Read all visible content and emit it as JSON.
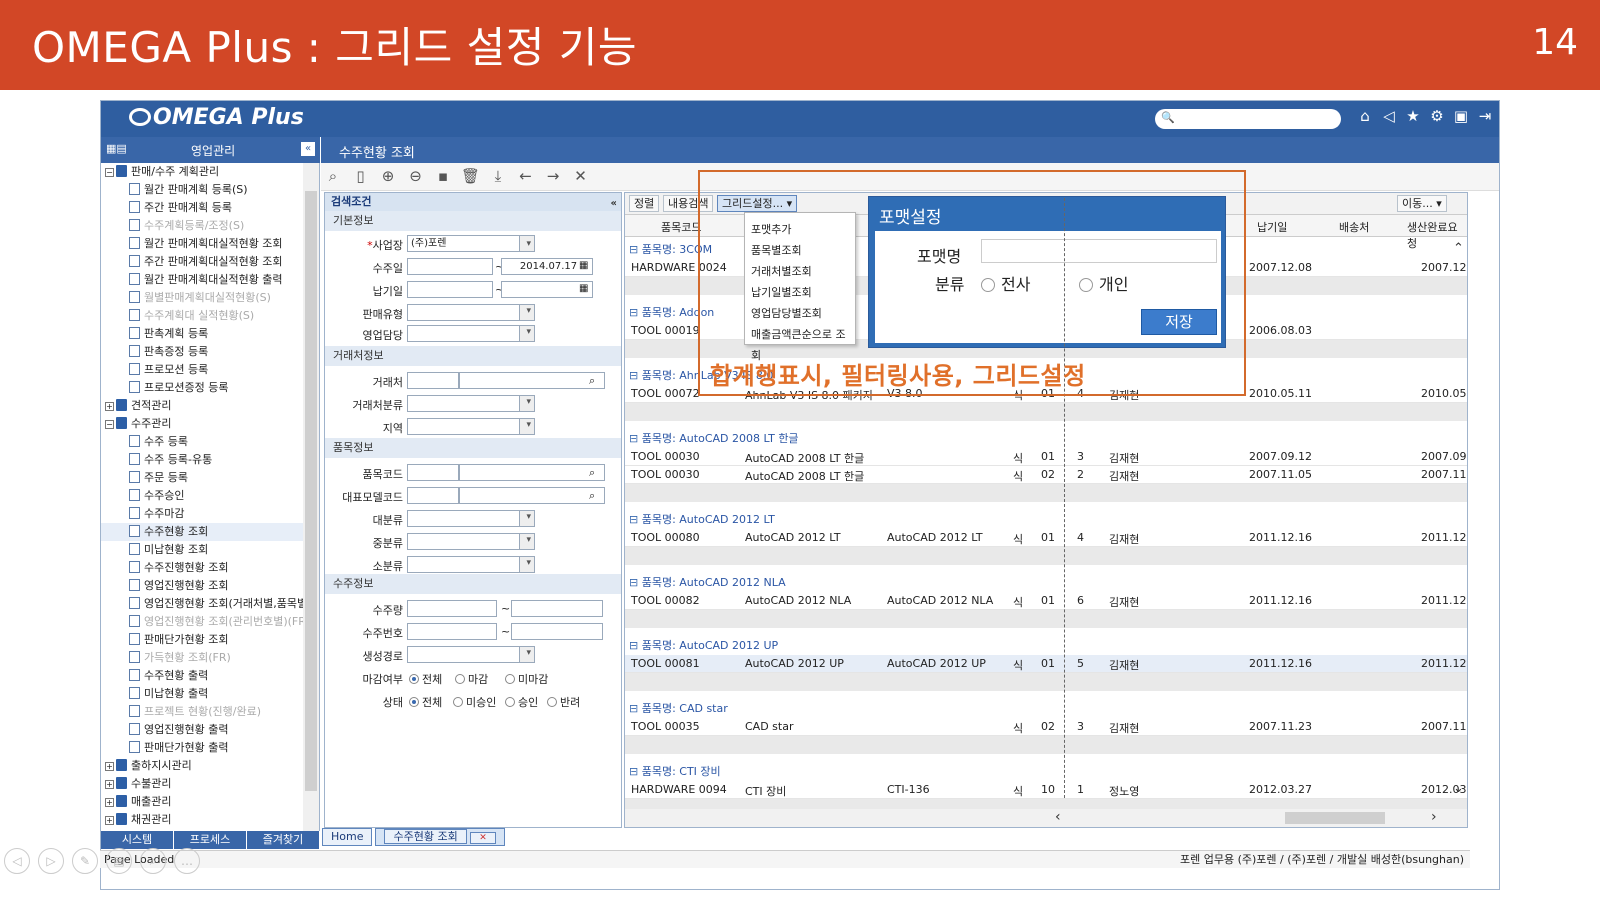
{
  "slide": {
    "title": "OMEGA Plus : 그리드 설정 기능",
    "number": "14"
  },
  "app": {
    "logo": "OMEGA Plus",
    "search_icon": "search-icon",
    "top_icons": [
      "home-icon",
      "back-icon",
      "star-icon",
      "gear-icon",
      "layout-icon",
      "logout-icon"
    ]
  },
  "sidebar": {
    "header": "영업관리",
    "items": [
      {
        "label": "판매/수주 계획관리",
        "type": "folder",
        "open": true
      },
      {
        "label": "월간 판매계획 등록(S)",
        "type": "page"
      },
      {
        "label": "주간 판매계획 등록",
        "type": "page"
      },
      {
        "label": "수주계획등록/조정(S)",
        "type": "page",
        "disabled": true
      },
      {
        "label": "월간 판매계획대실적현황 조회",
        "type": "page"
      },
      {
        "label": "주간 판매계획대실적현황 조회",
        "type": "page"
      },
      {
        "label": "월간 판매계획대실적현황 출력",
        "type": "page"
      },
      {
        "label": "월별판매계획대실적현황(S)",
        "type": "page",
        "disabled": true
      },
      {
        "label": "수주계획대 실적현황(S)",
        "type": "page",
        "disabled": true
      },
      {
        "label": "판촉계획 등록",
        "type": "page"
      },
      {
        "label": "판촉증정 등록",
        "type": "page"
      },
      {
        "label": "프로모션 등록",
        "type": "page"
      },
      {
        "label": "프로모션증정 등록",
        "type": "page"
      },
      {
        "label": "견적관리",
        "type": "folder",
        "open": false
      },
      {
        "label": "수주관리",
        "type": "folder",
        "open": true
      },
      {
        "label": "수주 등록",
        "type": "page"
      },
      {
        "label": "수주 등록-유통",
        "type": "page"
      },
      {
        "label": "주문 등록",
        "type": "page"
      },
      {
        "label": "수주승인",
        "type": "page"
      },
      {
        "label": "수주마감",
        "type": "page"
      },
      {
        "label": "수주현황 조회",
        "type": "page",
        "selected": true
      },
      {
        "label": "미납현황 조회",
        "type": "page"
      },
      {
        "label": "수주진행현황 조회",
        "type": "page"
      },
      {
        "label": "영업진행현황 조회",
        "type": "page"
      },
      {
        "label": "영업진행현황 조회(거래처별,품목별)",
        "type": "page"
      },
      {
        "label": "영업진행현황 조회(관리번호별)(FR)",
        "type": "page",
        "disabled": true
      },
      {
        "label": "판매단가현황 조회",
        "type": "page"
      },
      {
        "label": "가득현황 조회(FR)",
        "type": "page",
        "disabled": true
      },
      {
        "label": "수주현황 출력",
        "type": "page"
      },
      {
        "label": "미납현황 출력",
        "type": "page"
      },
      {
        "label": "프로젝트 현황(진행/완료)",
        "type": "page",
        "disabled": true
      },
      {
        "label": "영업진행현황 출력",
        "type": "page"
      },
      {
        "label": "판매단가현황 출력",
        "type": "page"
      },
      {
        "label": "출하지시관리",
        "type": "folder",
        "open": false
      },
      {
        "label": "수불관리",
        "type": "folder",
        "open": false
      },
      {
        "label": "매출관리",
        "type": "folder",
        "open": false
      },
      {
        "label": "채권관리",
        "type": "folder",
        "open": false
      }
    ],
    "tabs": [
      "시스템",
      "프로세스",
      "즐겨찾기"
    ]
  },
  "main": {
    "title": "수주현황 조회",
    "toolbar_icons": [
      "search-icon",
      "new-icon",
      "add-icon",
      "remove-icon",
      "save-icon",
      "delete-icon",
      "download-icon",
      "prev-icon",
      "next-icon",
      "close-icon"
    ]
  },
  "search_panel": {
    "title": "검색조건",
    "sections": {
      "basic": "기본정보",
      "partner": "거래처정보",
      "item": "품목정보",
      "order": "수주정보"
    },
    "fields": {
      "business": "사업장",
      "business_value": "(주)포렌",
      "order_date": "수주일",
      "order_date_to": "2014.07.17",
      "due_date": "납기일",
      "sales_type": "판매유형",
      "sales_rep": "영업담당",
      "partner": "거래처",
      "partner_class": "거래처분류",
      "region": "지역",
      "item_code": "품목코드",
      "model_code": "대표모델코드",
      "cat_large": "대분류",
      "cat_mid": "중분류",
      "cat_small": "소분류",
      "qty": "수주량",
      "order_no": "수주번호",
      "route": "생성경로",
      "closing": "마감여부",
      "state": "상태"
    },
    "closing_options": [
      "전체",
      "마감",
      "미마감"
    ],
    "state_options": [
      "전체",
      "미승인",
      "승인",
      "반려"
    ],
    "tilde": "~"
  },
  "grid": {
    "toolbar": {
      "sort": "정렬",
      "content_search": "내용검색",
      "grid_settings": "그리드설정...",
      "move": "이동..."
    },
    "columns": {
      "item_code": "품목코드",
      "due": "납기일",
      "ship": "배송처",
      "done": "생산완료요청"
    },
    "group_prefix": "품목명: ",
    "groups": [
      {
        "name": "3COM",
        "rows": [
          {
            "code": "HARDWARE 0024",
            "name": "",
            "spec": "",
            "unit": "",
            "cat": "",
            "qty": "",
            "rep": "",
            "due": "2007.12.08",
            "done": "2007.12"
          }
        ]
      },
      {
        "name": "Addon",
        "rows": [
          {
            "code": "TOOL 00019",
            "name": "",
            "spec": "",
            "unit": "",
            "cat": "",
            "qty": "",
            "rep": "",
            "due": "2006.08.03",
            "done": ""
          }
        ]
      },
      {
        "name": "AhnLab V3 IS 8.0",
        "rows": [
          {
            "code": "TOOL 00072",
            "name": "AhnLab V3 IS 8.0 패키지",
            "spec": "V3 8.0",
            "unit": "식",
            "cat": "01",
            "qty": "4",
            "rep": "김재현",
            "due": "2010.05.11",
            "done": "2010.05"
          }
        ]
      },
      {
        "name": "AutoCAD 2008 LT 한글",
        "rows": [
          {
            "code": "TOOL 00030",
            "name": "AutoCAD 2008 LT 한글",
            "spec": "",
            "unit": "식",
            "cat": "01",
            "qty": "3",
            "rep": "김재현",
            "due": "2007.09.12",
            "done": "2007.09"
          },
          {
            "code": "TOOL 00030",
            "name": "AutoCAD 2008 LT 한글",
            "spec": "",
            "unit": "식",
            "cat": "02",
            "qty": "2",
            "rep": "김재현",
            "due": "2007.11.05",
            "done": "2007.11"
          }
        ]
      },
      {
        "name": "AutoCAD 2012 LT",
        "rows": [
          {
            "code": "TOOL 00080",
            "name": "AutoCAD 2012 LT",
            "spec": "AutoCAD 2012 LT",
            "unit": "식",
            "cat": "01",
            "qty": "4",
            "rep": "김재현",
            "due": "2011.12.16",
            "done": "2011.12"
          }
        ]
      },
      {
        "name": "AutoCAD 2012 NLA",
        "rows": [
          {
            "code": "TOOL 00082",
            "name": "AutoCAD 2012 NLA",
            "spec": "AutoCAD 2012 NLA",
            "unit": "식",
            "cat": "01",
            "qty": "6",
            "rep": "김재현",
            "due": "2011.12.16",
            "done": "2011.12"
          }
        ]
      },
      {
        "name": "AutoCAD 2012 UP",
        "rows": [
          {
            "code": "TOOL 00081",
            "name": "AutoCAD 2012 UP",
            "spec": "AutoCAD 2012 UP",
            "unit": "식",
            "cat": "01",
            "qty": "5",
            "rep": "김재현",
            "due": "2011.12.16",
            "done": "2011.12",
            "hl": true
          }
        ]
      },
      {
        "name": "CAD star",
        "rows": [
          {
            "code": "TOOL 00035",
            "name": "CAD star",
            "spec": "",
            "unit": "식",
            "cat": "02",
            "qty": "3",
            "rep": "김재현",
            "due": "2007.11.23",
            "done": "2007.11"
          }
        ]
      },
      {
        "name": "CTI 장비",
        "rows": [
          {
            "code": "HARDWARE 0094",
            "name": "CTI 장비",
            "spec": "CTI-136",
            "unit": "식",
            "cat": "10",
            "qty": "1",
            "rep": "정노영",
            "due": "2012.03.27",
            "done": "2012.03"
          }
        ]
      }
    ]
  },
  "menu": {
    "items": [
      "포맷추가",
      "품목별조회",
      "거래처별조회",
      "납기일별조회",
      "영업담당별조회",
      "매출금액큰순으로 조회"
    ]
  },
  "format_dialog": {
    "title": "포맷설정",
    "name_label": "포맷명",
    "class_label": "분류",
    "opt_company": "전사",
    "opt_personal": "개인",
    "save": "저장"
  },
  "annotation": "합계행표시, 필터링사용, 그리드설정",
  "bottom_tabs": [
    "Home",
    "수주현황 조회"
  ],
  "status": {
    "left": "Page Loaded",
    "right": "포렌 업무용  (주)포렌 / (주)포렌 / 개발실  배성한(bsunghan)"
  }
}
